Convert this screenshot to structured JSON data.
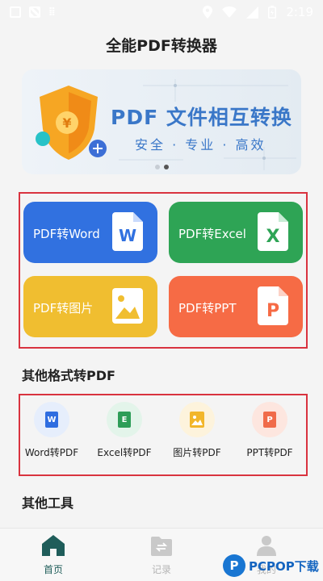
{
  "status": {
    "time": "2:19"
  },
  "app": {
    "title": "全能PDF转换器"
  },
  "banner": {
    "title": "PDF 文件相互转换",
    "subtitle": "安全 · 专业 · 高效",
    "page_count": 2,
    "active_page": 2
  },
  "main_tools": [
    {
      "label": "PDF转Word",
      "icon_letter": "W",
      "color": "#3171e0"
    },
    {
      "label": "PDF转Excel",
      "icon_letter": "X",
      "color": "#2ea455"
    },
    {
      "label": "PDF转图片",
      "color": "#f0be30"
    },
    {
      "label": "PDF转PPT",
      "icon_letter": "P",
      "color": "#f66b45"
    }
  ],
  "other_formats": {
    "title": "其他格式转PDF",
    "items": [
      {
        "label": "Word转PDF",
        "icon_letter": "W",
        "color": "#2f6de0"
      },
      {
        "label": "Excel转PDF",
        "icon_letter": "E",
        "color": "#2e9d58"
      },
      {
        "label": "图片转PDF",
        "color": "#f2b62a"
      },
      {
        "label": "PPT转PDF",
        "icon_letter": "P",
        "color": "#f06b4a"
      }
    ]
  },
  "other_tools": {
    "title": "其他工具"
  },
  "tabs": [
    {
      "label": "首页",
      "active": true
    },
    {
      "label": "记录",
      "active": false
    },
    {
      "label": "我的",
      "active": false
    }
  ],
  "watermark": {
    "text": "PCPOP下载"
  }
}
